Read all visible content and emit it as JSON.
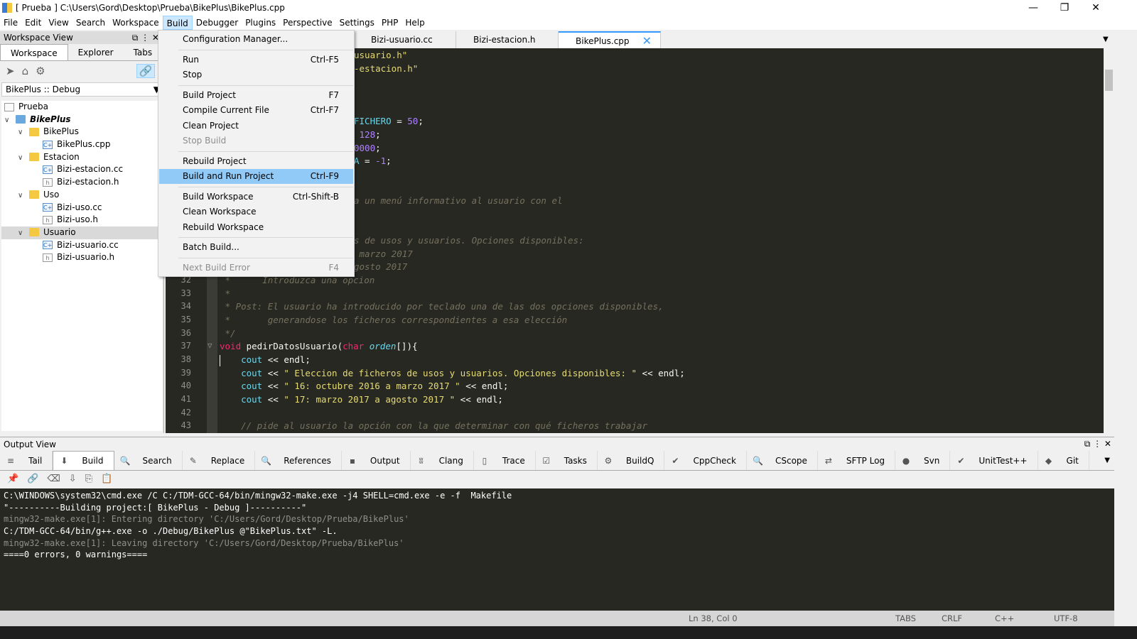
{
  "title": "[ Prueba ] C:\\Users\\Gord\\Desktop\\Prueba\\BikePlus\\BikePlus.cpp",
  "menubar": [
    "File",
    "Edit",
    "View",
    "Search",
    "Workspace",
    "Build",
    "Debugger",
    "Plugins",
    "Perspective",
    "Settings",
    "PHP",
    "Help"
  ],
  "workspace": {
    "title": "Workspace View",
    "tabs": [
      "Workspace",
      "Explorer",
      "Tabs"
    ],
    "config": "BikePlus :: Debug",
    "tree": [
      {
        "label": "Prueba",
        "level": 0,
        "icon": "workspace"
      },
      {
        "label": "BikePlus",
        "level": 0,
        "icon": "project",
        "bold": true
      },
      {
        "label": "BikePlus",
        "level": 1,
        "icon": "folder"
      },
      {
        "label": "BikePlus.cpp",
        "level": 2,
        "icon": "cpp"
      },
      {
        "label": "Estacion",
        "level": 1,
        "icon": "folder"
      },
      {
        "label": "Bizi-estacion.cc",
        "level": 2,
        "icon": "cpp"
      },
      {
        "label": "Bizi-estacion.h",
        "level": 2,
        "icon": "h"
      },
      {
        "label": "Uso",
        "level": 1,
        "icon": "folder"
      },
      {
        "label": "Bizi-uso.cc",
        "level": 2,
        "icon": "cpp"
      },
      {
        "label": "Bizi-uso.h",
        "level": 2,
        "icon": "h"
      },
      {
        "label": "Usuario",
        "level": 1,
        "icon": "folder",
        "selected": true
      },
      {
        "label": "Bizi-usuario.cc",
        "level": 2,
        "icon": "cpp"
      },
      {
        "label": "Bizi-usuario.h",
        "level": 2,
        "icon": "h"
      }
    ]
  },
  "editor_tabs": [
    {
      "label": "Bizi-usuario.cc"
    },
    {
      "label": "Bizi-estacion.h"
    },
    {
      "label": "BikePlus.cpp",
      "active": true
    }
  ],
  "build_menu": [
    {
      "label": "Configuration Manager..."
    },
    {
      "sep": true
    },
    {
      "label": "Run",
      "shortcut": "Ctrl-F5"
    },
    {
      "label": "Stop"
    },
    {
      "sep": true
    },
    {
      "label": "Build Project",
      "shortcut": "F7"
    },
    {
      "label": "Compile Current File",
      "shortcut": "Ctrl-F7"
    },
    {
      "label": "Clean Project"
    },
    {
      "label": "Stop Build",
      "disabled": true
    },
    {
      "sep": true
    },
    {
      "label": "Rebuild Project"
    },
    {
      "label": "Build and Run Project",
      "shortcut": "Ctrl-F9",
      "highlighted": true
    },
    {
      "sep": true
    },
    {
      "label": "Build Workspace",
      "shortcut": "Ctrl-Shift-B"
    },
    {
      "label": "Clean Workspace"
    },
    {
      "label": "Rebuild Workspace"
    },
    {
      "sep": true
    },
    {
      "label": "Batch Build..."
    },
    {
      "sep": true
    },
    {
      "label": "Next Build Error",
      "shortcut": "F4",
      "disabled": true
    }
  ],
  "code_fragments": [
    {
      "line": 15,
      "html": "<span class='st'>usuario.h\"</span>"
    },
    {
      "line": 16,
      "html": "<span class='st'>-estacion.h\"</span>"
    },
    {
      "line": 20,
      "html": "<span class='ty'>FICHERO</span> = <span class='nu'>50</span>;"
    },
    {
      "line": 21,
      "html": " <span class='nu'>128</span>;"
    },
    {
      "line": 22,
      "html": "<span class='nu'>0000</span>;"
    },
    {
      "line": 23,
      "html": "<span class='ty'>A</span> = <span class='nu'>-1</span>;"
    },
    {
      "line": 26,
      "html": "<span class='cm'>a un menú informativo al usuario con el</span>"
    },
    {
      "line": 29,
      "html": "<span class='cm'>s de usos y usuarios. Opciones disponibles:</span>"
    },
    {
      "line": 30,
      "html": "<span class='cm'> marzo 2017</span>"
    },
    {
      "line": 31,
      "html": "<span class='cm'>gosto 2017</span>"
    }
  ],
  "code_lines": [
    {
      "n": "32",
      "html": "<span class='cm'> *      Introduzca una opcion</span>"
    },
    {
      "n": "33",
      "html": "<span class='cm'> *</span>"
    },
    {
      "n": "34",
      "html": "<span class='cm'> * Post: El usuario ha introducido por teclado una de las dos opciones disponibles,</span>"
    },
    {
      "n": "35",
      "html": "<span class='cm'> *       generandose los ficheros correspondientes a esa elección</span>"
    },
    {
      "n": "36",
      "html": "<span class='cm'> */</span>"
    },
    {
      "n": "37",
      "html": "<span class='kw'>void</span> pedirDatosUsuario(<span class='kw'>char</span> <span class='ty' style='font-style:italic'>orden</span>[]){"
    },
    {
      "n": "38",
      "html": "    <span class='ty'>cout</span> &lt;&lt; endl;"
    },
    {
      "n": "39",
      "html": "    <span class='ty'>cout</span> &lt;&lt; <span class='st'>\" Eleccion de ficheros de usos y usuarios. Opciones disponibles: \"</span> &lt;&lt; endl;"
    },
    {
      "n": "40",
      "html": "    <span class='ty'>cout</span> &lt;&lt; <span class='st'>\" 16: octubre 2016 a marzo 2017 \"</span> &lt;&lt; endl;"
    },
    {
      "n": "41",
      "html": "    <span class='ty'>cout</span> &lt;&lt; <span class='st'>\" 17: marzo 2017 a agosto 2017 \"</span> &lt;&lt; endl;"
    },
    {
      "n": "42",
      "html": ""
    },
    {
      "n": "43",
      "html": "    <span class='cm'>// pide al usuario la opción con la que determinar con qué ficheros trabajar</span>"
    }
  ],
  "output": {
    "title": "Output View",
    "tabs": [
      {
        "label": "Tail",
        "icon": "≡"
      },
      {
        "label": "Build",
        "icon": "⬇",
        "active": true
      },
      {
        "label": "Search",
        "icon": "🔍"
      },
      {
        "label": "Replace",
        "icon": "✎"
      },
      {
        "label": "References",
        "icon": "🔍"
      },
      {
        "label": "Output",
        "icon": "▪"
      },
      {
        "label": "Clang",
        "icon": "ʬ"
      },
      {
        "label": "Trace",
        "icon": "▯"
      },
      {
        "label": "Tasks",
        "icon": "☑"
      },
      {
        "label": "BuildQ",
        "icon": "⚙"
      },
      {
        "label": "CppCheck",
        "icon": "✔"
      },
      {
        "label": "CScope",
        "icon": "🔍"
      },
      {
        "label": "SFTP Log",
        "icon": "⇄"
      },
      {
        "label": "Svn",
        "icon": "●"
      },
      {
        "label": "UnitTest++",
        "icon": "✔"
      },
      {
        "label": "Git",
        "icon": "◆"
      }
    ],
    "lines": [
      {
        "text": "C:\\WINDOWS\\system32\\cmd.exe /C C:/TDM-GCC-64/bin/mingw32-make.exe -j4 SHELL=cmd.exe -e -f  Makefile",
        "color": "#ffffff"
      },
      {
        "text": "\"----------Building project:[ BikePlus - Debug ]----------\"",
        "color": "#ffffff"
      },
      {
        "text": "mingw32-make.exe[1]: Entering directory 'C:/Users/Gord/Desktop/Prueba/BikePlus'",
        "color": "#8f908a"
      },
      {
        "text": "C:/TDM-GCC-64/bin/g++.exe -o ./Debug/BikePlus @\"BikePlus.txt\" -L.",
        "color": "#ffffff"
      },
      {
        "text": "mingw32-make.exe[1]: Leaving directory 'C:/Users/Gord/Desktop/Prueba/BikePlus'",
        "color": "#8f908a"
      },
      {
        "text": "====0 errors, 0 warnings====",
        "color": "#ffffff"
      }
    ]
  },
  "status": {
    "position": "Ln 38, Col 0",
    "indent": "TABS",
    "eol": "CRLF",
    "lang": "C++",
    "encoding": "UTF-8"
  }
}
